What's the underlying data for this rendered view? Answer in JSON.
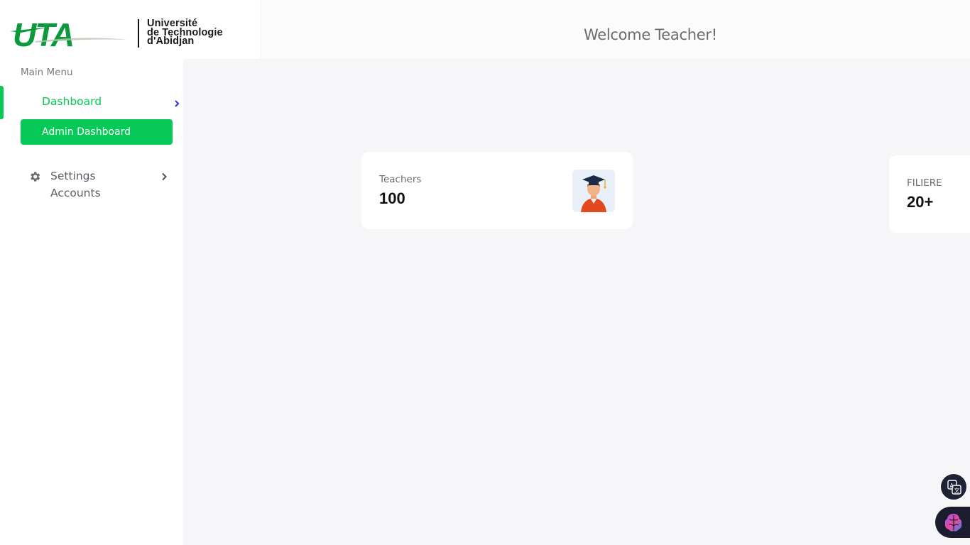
{
  "header": {
    "logo": {
      "mark": "UTA",
      "line1": "Université",
      "line2": "de Technologie",
      "line3": "d'Abidjan"
    },
    "welcome": "Welcome Teacher!"
  },
  "sidebar": {
    "menu_title": "Main Menu",
    "dashboard_label": "Dashboard",
    "admin_dashboard_label": "Admin Dashboard",
    "settings_label": "Settings",
    "accounts_label": "Accounts"
  },
  "cards": [
    {
      "label": "Teachers",
      "value": "100",
      "icon": "graduate-avatar-icon"
    },
    {
      "label": "FILIERE",
      "value": "20+"
    }
  ],
  "colors": {
    "accent_green": "#06c958",
    "main_bg": "#f6f6f8",
    "chevron_blue": "#3b3bd6"
  },
  "floating": {
    "translate_icon": "translate-icon",
    "assistant_icon": "brain-icon"
  }
}
